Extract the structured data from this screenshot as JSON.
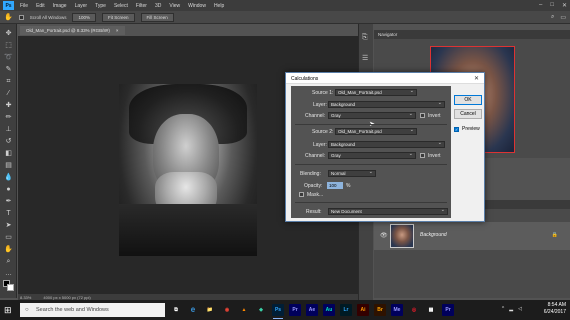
{
  "app": {
    "logo": "Ps"
  },
  "menu": [
    "File",
    "Edit",
    "Image",
    "Layer",
    "Type",
    "Select",
    "Filter",
    "3D",
    "View",
    "Window",
    "Help"
  ],
  "window_controls": [
    "–",
    "□",
    "✕"
  ],
  "options_bar": {
    "scroll_all": "Scroll All Windows",
    "zoom": "100%",
    "fit_screen": "Fit Screen",
    "fill_screen": "Fill Screen"
  },
  "document_tab": {
    "title": "Old_Man_Portrait.psd @ 8.33% (RGB/8#)",
    "close": "×"
  },
  "status_bar": {
    "zoom": "8.33%",
    "doc": "4000 px x 5000 px (72 ppi)"
  },
  "navigator": {
    "title": "Navigator"
  },
  "layers": {
    "layer_name": "Background",
    "lock": "🔒",
    "eye": "👁"
  },
  "dialog": {
    "title": "Calculations",
    "close": "✕",
    "source1": {
      "label": "Source 1:",
      "value": "Old_Man_Portrait.psd"
    },
    "layer1": {
      "label": "Layer:",
      "value": "Background"
    },
    "channel1": {
      "label": "Channel:",
      "value": "Gray",
      "invert": "Invert"
    },
    "source2": {
      "label": "Source 2:",
      "value": "Old_Man_Portrait.psd"
    },
    "layer2": {
      "label": "Layer:",
      "value": "Background"
    },
    "channel2": {
      "label": "Channel:",
      "value": "Gray",
      "invert": "Invert"
    },
    "blending": {
      "label": "Blending:",
      "value": "Normal"
    },
    "opacity": {
      "label": "Opacity:",
      "value": "100",
      "unit": "%"
    },
    "mask": "Mask...",
    "result": {
      "label": "Result:",
      "value": "New Document"
    },
    "ok": "OK",
    "cancel": "Cancel",
    "preview": "Preview"
  },
  "taskbar": {
    "search_placeholder": "Search the web and Windows",
    "apps": [
      "⧉",
      "e",
      "📁",
      "◉",
      "▲",
      "◆",
      "Ps",
      "Pr",
      "Ae",
      "Au",
      "Lr",
      "Ai",
      "Br",
      "Me",
      "◎",
      "▦",
      "Pr"
    ],
    "time": "8:54 AM",
    "date": "6/24/2017"
  }
}
